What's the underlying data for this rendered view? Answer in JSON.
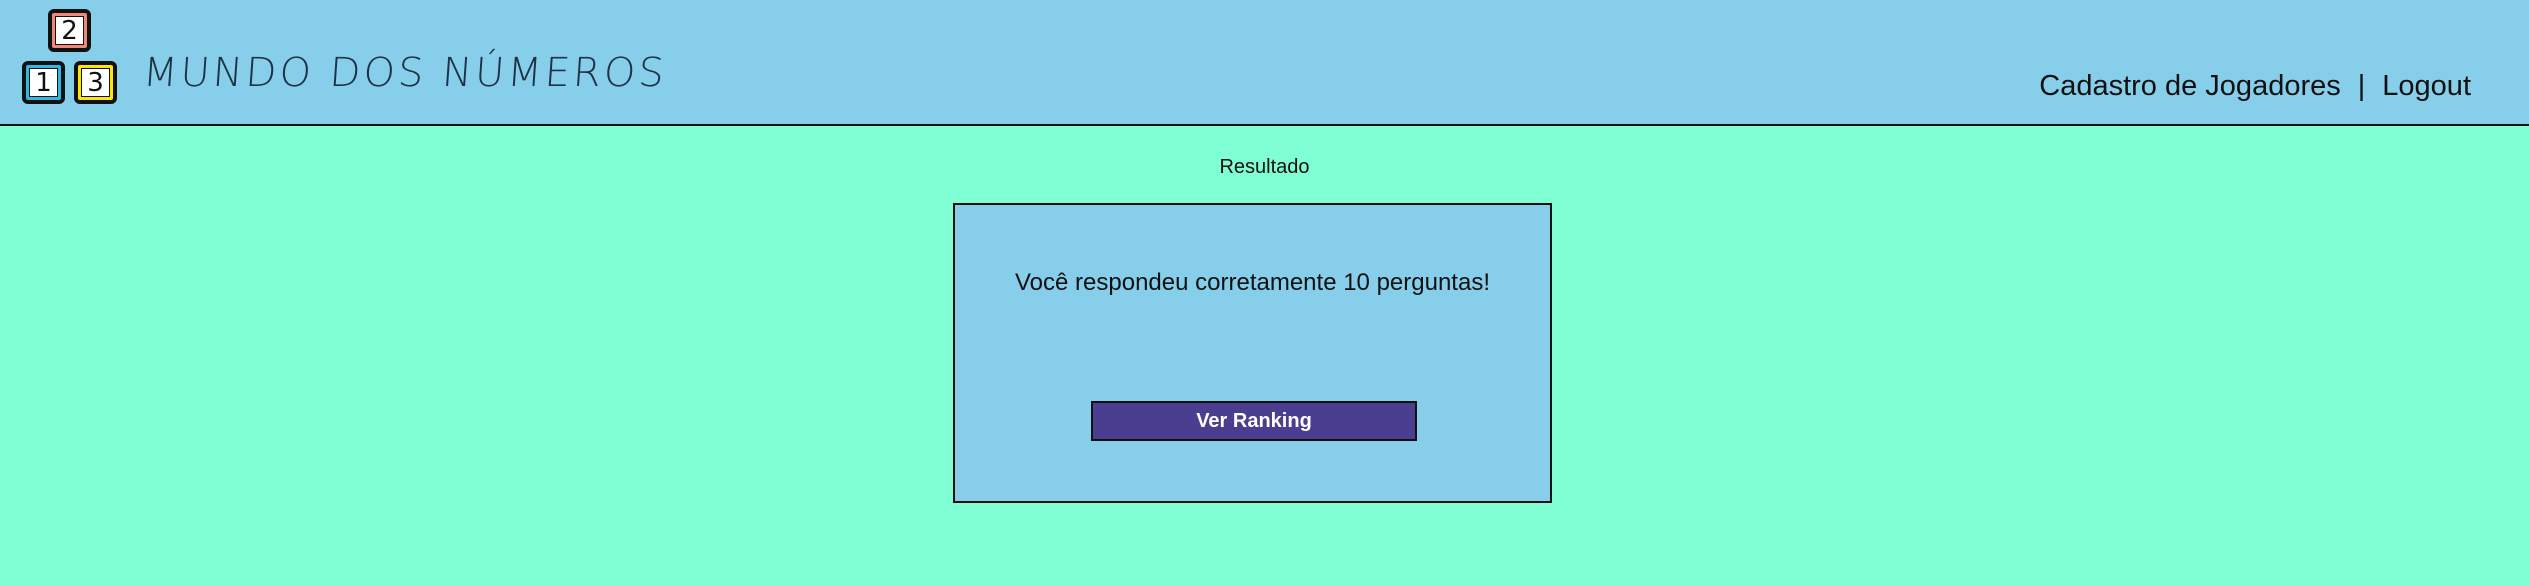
{
  "header": {
    "logo_blocks": [
      {
        "digit": "2",
        "color": "#f08878"
      },
      {
        "digit": "1",
        "color": "#2db8e6"
      },
      {
        "digit": "3",
        "color": "#ffe600"
      }
    ],
    "brand_name": "MUNDO DOS NÚMEROS",
    "nav": {
      "register_players": "Cadastro de Jogadores",
      "separator": "|",
      "logout": "Logout"
    }
  },
  "main": {
    "title": "Resultado",
    "message": "Você respondeu corretamente 10 perguntas!",
    "ranking_button": "Ver Ranking"
  },
  "colors": {
    "page_background": "#80ffd4",
    "header_background": "#87ceeb",
    "card_background": "#87ceeb",
    "button_background": "#4b3d8f"
  }
}
